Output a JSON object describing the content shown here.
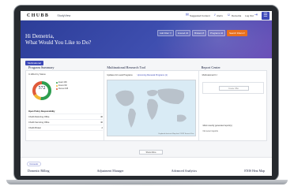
{
  "topbar": {
    "logo": "CHUBB",
    "app_name": "StudyView",
    "links": [
      {
        "icon": "chat-bubble-icon",
        "glyph": "✉",
        "label": "Suggested Content"
      },
      {
        "icon": "bell-icon",
        "glyph": "♪",
        "label": "Alerts"
      },
      {
        "icon": "user-icon",
        "glyph": "☺",
        "label": "Demetria"
      },
      {
        "icon": "logout-icon",
        "glyph": "⇥",
        "label": "Log Out"
      }
    ],
    "menu_glyph": "☰"
  },
  "hero": {
    "greeting_line1": "Hi Demetria,",
    "greeting_line2": "What Would You Like to Do?",
    "chips": [
      {
        "label": "Add Filter ▽",
        "primary": false
      },
      {
        "label": "Insured 22",
        "primary": false
      },
      {
        "label": "Brokers 8",
        "primary": false
      },
      {
        "label": "Programs 44",
        "primary": false
      },
      {
        "label": "Search Filters ▾",
        "primary": true
      }
    ]
  },
  "multinational_tab": "Multinational",
  "program_summary": {
    "title": "Program Summary",
    "subtitle": "In Effect by Status",
    "total": "572",
    "legend": [
      {
        "label": "Exact 296",
        "color": "#2e9e4f"
      },
      {
        "label": "Extend 82",
        "color": "#f2b632"
      },
      {
        "label": "Renew 198",
        "color": "#e05a3a"
      }
    ],
    "donut_fractions": [
      0.52,
      0.14,
      0.34
    ],
    "responsibility_header": "Open Policy Responsibility",
    "rows": [
      {
        "label": "Chubb Referring Office",
        "value": "40"
      },
      {
        "label": "Chubb Servicing Office",
        "value": "40"
      },
      {
        "label": "Chubb Broker",
        "value": "2"
      }
    ]
  },
  "research_tool": {
    "title": "Multinational Research Tool",
    "dropdown_label": "Updates for Local Programs",
    "toggle_label": "Upcoming Renewal Programs (1)",
    "map_note": "Keyboard shortcuts  Map data ©2023  Terms of Use"
  },
  "report_center": {
    "title": "Report Center",
    "box_label": "Multinational KJ",
    "box_button": "Create Offer",
    "footer1": "Most recently generated report(s)",
    "footer2": "No recent reports"
  },
  "show_more": "Show More",
  "domestic_badge": "Domestic",
  "bottom_links": [
    "Domestic Billing",
    "Adjustment Manager",
    "Advanced Analytics",
    "ENIS Heat Map"
  ]
}
